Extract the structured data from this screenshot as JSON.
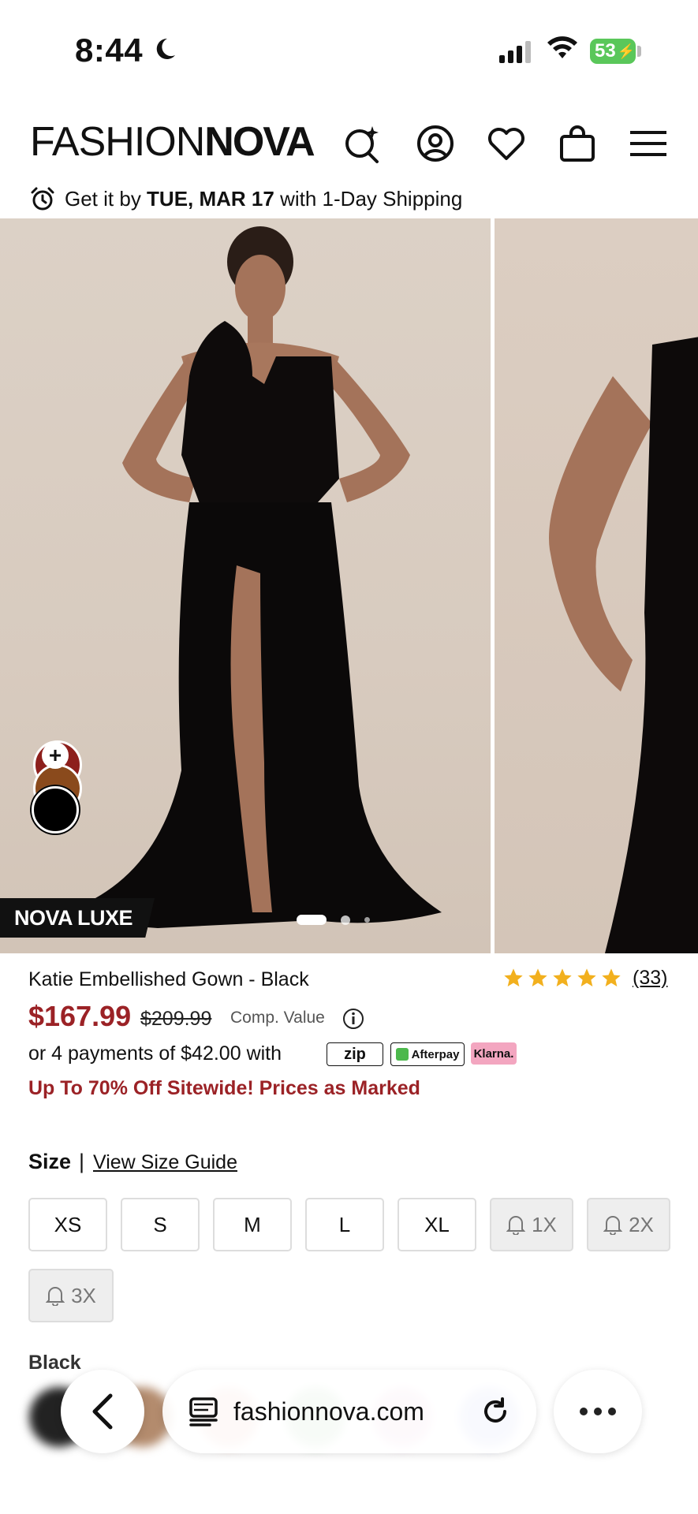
{
  "status_bar": {
    "time": "8:44",
    "battery": "53"
  },
  "header": {
    "logo_light": "FASHION",
    "logo_bold": "NOVA",
    "icons": [
      "search-sparkle-icon",
      "account-icon",
      "wishlist-heart-icon",
      "bag-icon",
      "menu-icon"
    ]
  },
  "shipping": {
    "prefix": "Get it by ",
    "date": "TUE, MAR 17",
    "suffix": " with 1-Day Shipping"
  },
  "gallery": {
    "badge": "NOVA LUXE",
    "swatch_add": "+",
    "swatch_colors": [
      "#8d1f1c",
      "#8a4a1c",
      "#000000"
    ],
    "dots_total": 3,
    "dots_active": 1
  },
  "product": {
    "name": "Katie Embellished Gown - Black",
    "rating_stars": 5,
    "rating_count": "(33)",
    "price": "$167.99",
    "old_price": "$209.99",
    "comp_value": "Comp. Value",
    "payments": "or 4 payments of $42.00 with",
    "pay_providers": {
      "zip": "zip",
      "afterpay": "Afterpay",
      "klarna": "Klarna."
    },
    "promo": "Up To 70% Off Sitewide! Prices as Marked"
  },
  "size": {
    "label": "Size",
    "separator": "|",
    "guide": "View Size Guide",
    "options": [
      {
        "label": "XS",
        "available": true
      },
      {
        "label": "S",
        "available": true
      },
      {
        "label": "M",
        "available": true
      },
      {
        "label": "L",
        "available": true
      },
      {
        "label": "XL",
        "available": true
      },
      {
        "label": "1X",
        "available": false
      },
      {
        "label": "2X",
        "available": false
      },
      {
        "label": "3X",
        "available": false
      }
    ]
  },
  "color": {
    "label": "Black"
  },
  "browser": {
    "url": "fashionnova.com"
  },
  "colors": {
    "accent_red": "#9b2226",
    "star": "#f2b01e"
  }
}
